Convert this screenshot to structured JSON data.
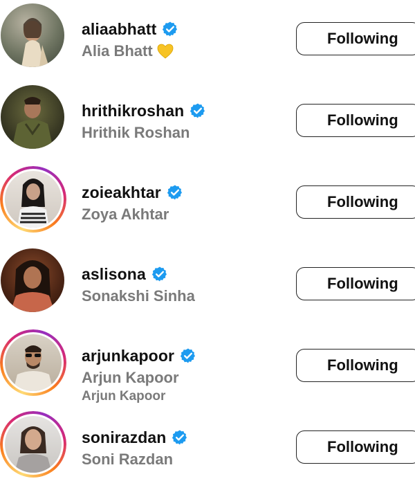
{
  "accounts": [
    {
      "username": "aliaabhatt",
      "full_name": "Alia Bhatt",
      "name_emoji": "yellow-heart",
      "button": "Following",
      "verified": true,
      "story_ring": false
    },
    {
      "username": "hrithikroshan",
      "full_name": "Hrithik Roshan",
      "button": "Following",
      "verified": true,
      "story_ring": false
    },
    {
      "username": "zoieakhtar",
      "full_name": "Zoya Akhtar",
      "button": "Following",
      "verified": true,
      "story_ring": true
    },
    {
      "username": "aslisona",
      "full_name": "Sonakshi Sinha",
      "button": "Following",
      "verified": true,
      "story_ring": false
    },
    {
      "username": "arjunkapoor",
      "full_name": "Arjun Kapoor",
      "secondary_text": "Arjun Kapoor",
      "button": "Following",
      "verified": true,
      "story_ring": true
    },
    {
      "username": "sonirazdan",
      "full_name": "Soni Razdan",
      "button": "Following",
      "verified": true,
      "story_ring": true
    }
  ],
  "colors": {
    "verified": "#1d9bf0",
    "username": "#111111",
    "full_name": "#7a7a7a",
    "button_border": "#222222",
    "story_ring": [
      "#feda75",
      "#fa7e1e",
      "#d62976",
      "#962fbf"
    ]
  },
  "icons": {
    "verified": "verified-badge-icon",
    "name_emoji": "yellow-heart-icon"
  }
}
